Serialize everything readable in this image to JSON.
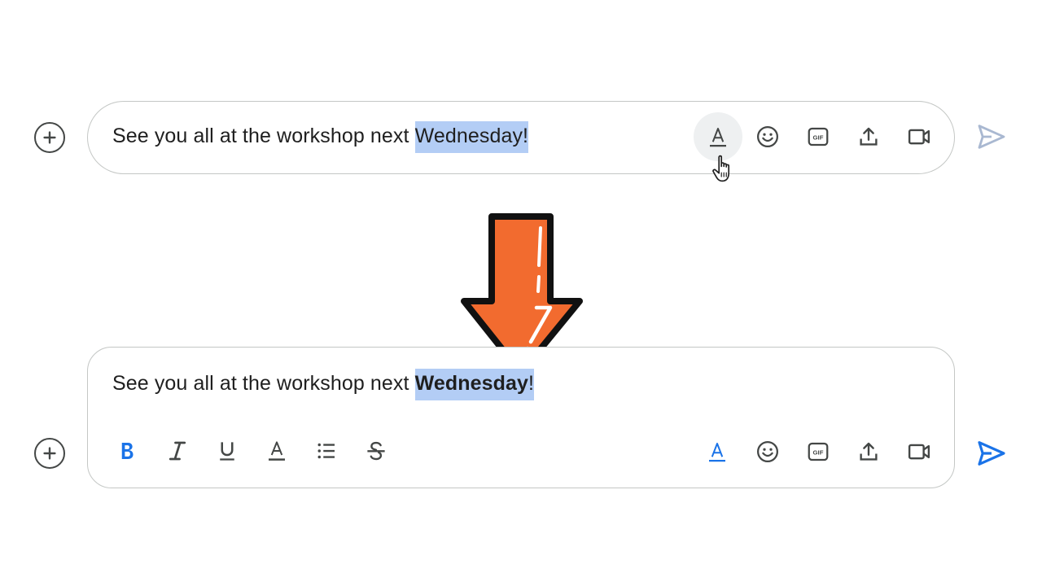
{
  "composer_before": {
    "message_prefix": "See you all at the workshop next ",
    "selected_text": "Wednesday!",
    "format_button_state": "hovered",
    "send_state": "disabled"
  },
  "composer_after": {
    "message_prefix": "See you all at the workshop next ",
    "selected_bold_text": "Wednesday",
    "selected_suffix": "!",
    "format_button_state": "active",
    "send_state": "enabled",
    "toolbar": [
      "bold-icon",
      "italic-icon",
      "underline-icon",
      "text-color-icon",
      "bulleted-list-icon",
      "strikethrough-icon"
    ]
  },
  "icons": {
    "add": "add-circle-icon",
    "format": "format-text-icon",
    "emoji": "emoji-icon",
    "gif": "gif-icon",
    "upload": "upload-icon",
    "video": "video-meeting-icon",
    "send": "send-icon",
    "cursor": "hand-pointer-icon",
    "transition": "down-arrow-icon"
  },
  "gif_label": "GIF",
  "colors": {
    "accent": "#1a73e8",
    "selection": "#b3cdf5",
    "arrow": "#f26b2f",
    "icon": "#444746",
    "send_disabled": "#a9b8d1",
    "border": "#c4c7c5"
  }
}
